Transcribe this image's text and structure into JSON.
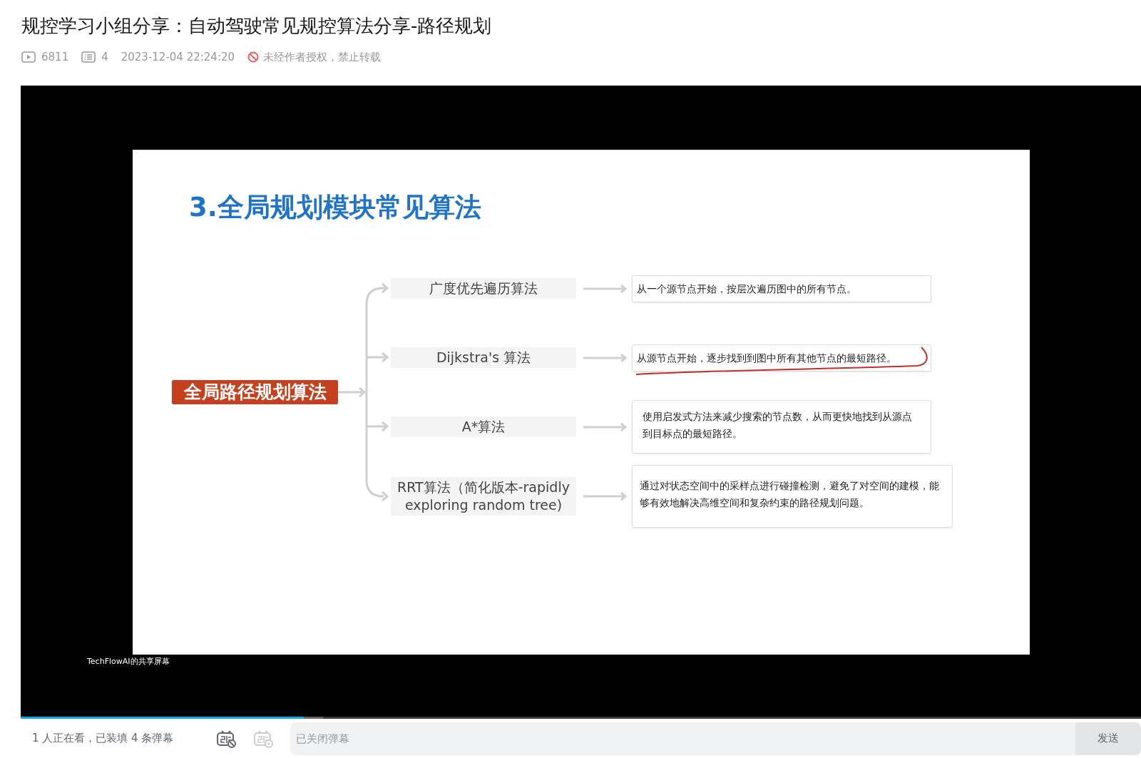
{
  "video": {
    "title": "规控学习小组分享：自动驾驶常见规控算法分享-路径规划",
    "views": "6811",
    "comments": "4",
    "date": "2023-12-04 22:24:20",
    "notice": "未经作者授权，禁止转载"
  },
  "slide": {
    "title": "3.全局规划模块常见算法",
    "root": "全局路径规划算法",
    "branches": [
      {
        "label": "广度优先遍历算法",
        "description": "从一个源节点开始，按层次遍历图中的所有节点。",
        "annotated": false
      },
      {
        "label": "Dijkstra's 算法",
        "description": "从源节点开始，逐步找到到图中所有其他节点的最短路径。",
        "annotated": true
      },
      {
        "label": "A*算法",
        "description": "使用启发式方法来减少搜索的节点数，从而更快地找到从源点到目标点的最短路径。",
        "annotated": false
      },
      {
        "label": "RRT算法（简化版本-rapidly exploring random tree)",
        "description": "通过对状态空间中的采样点进行碰撞检测，避免了对空间的建模，能够有效地解决高维空间和复杂约束的路径规划问题。",
        "annotated": false
      }
    ]
  },
  "screen_share_label": "TechFlowAI的共享屏幕",
  "progress": {
    "level": 0.253
  },
  "danmaku_bar": {
    "status": "1 人正在看，已装填 4 条弹幕",
    "input": {
      "placeholder": "已关闭弹幕",
      "disabled": true
    },
    "send_button": "发送"
  }
}
